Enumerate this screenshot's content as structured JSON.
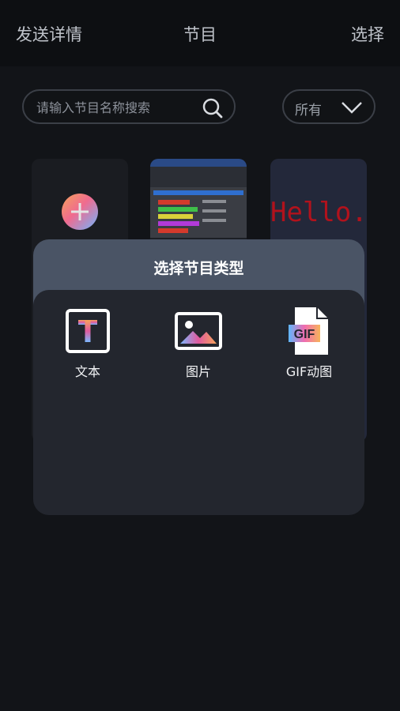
{
  "topbar": {
    "left_label": "发送详情",
    "title": "节目",
    "right_label": "选择"
  },
  "search": {
    "placeholder": "请输入节目名称搜索"
  },
  "filter": {
    "selected": "所有"
  },
  "programs": {
    "hello_text": "Hello."
  },
  "dialog": {
    "title": "选择节目类型",
    "options": [
      {
        "label": "文本",
        "icon": "text-type-icon"
      },
      {
        "label": "图片",
        "icon": "image-icon"
      },
      {
        "label": "GIF动图",
        "icon": "gif-file-icon"
      }
    ]
  },
  "colors": {
    "background": "#121418",
    "dialog_header": "#4a5465",
    "dialog_body": "#23262e",
    "hello_red": "#b1121c"
  }
}
